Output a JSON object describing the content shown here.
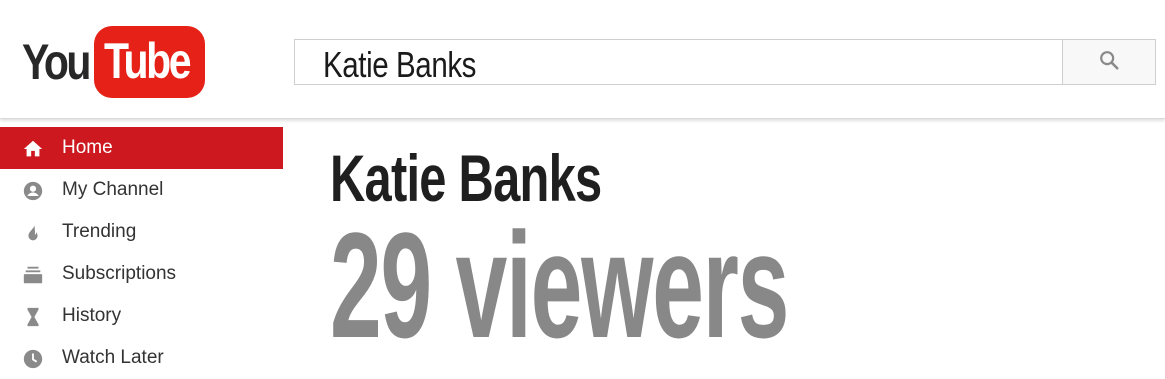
{
  "header": {
    "logo": {
      "you": "You",
      "tube": "Tube",
      "brand_color": "#e62117"
    },
    "search": {
      "value": "Katie Banks",
      "button_icon": "search-icon"
    }
  },
  "sidebar": {
    "items": [
      {
        "label": "Home",
        "icon": "home-icon",
        "active": true
      },
      {
        "label": "My Channel",
        "icon": "account-icon",
        "active": false
      },
      {
        "label": "Trending",
        "icon": "flame-icon",
        "active": false
      },
      {
        "label": "Subscriptions",
        "icon": "subscriptions-icon",
        "active": false
      },
      {
        "label": "History",
        "icon": "hourglass-icon",
        "active": false
      },
      {
        "label": "Watch Later",
        "icon": "clock-icon",
        "active": false
      }
    ],
    "active_color": "#cc181e"
  },
  "main": {
    "channel_name": "Katie Banks",
    "viewers_text": "29 viewers"
  }
}
